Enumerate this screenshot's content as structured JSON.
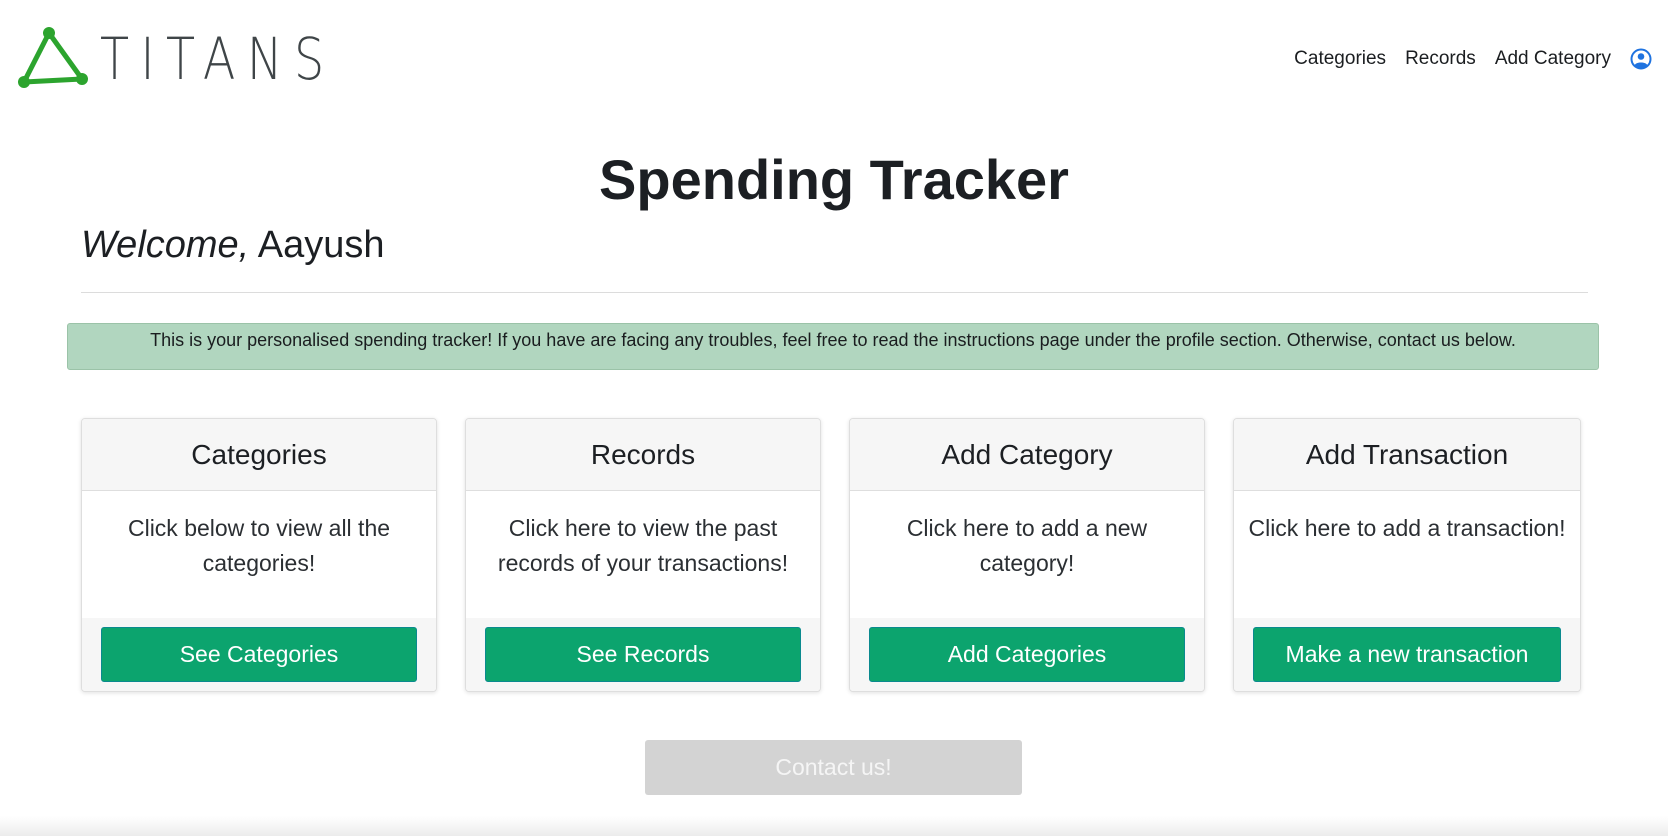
{
  "brand": {
    "name": "TITANS",
    "logo_icon": "triangle-network-icon",
    "logo_color": "#2ca42e"
  },
  "nav": {
    "links": [
      "Categories",
      "Records",
      "Add Category"
    ],
    "profile_icon": "user-circle-icon",
    "profile_color": "#1f73e0"
  },
  "main": {
    "title": "Spending Tracker",
    "welcome_prefix": "Welcome,",
    "user_name": "Aayush",
    "alert_text": "This is your personalised spending tracker! If you have are facing any troubles, feel free to read the instructions page under the profile section. Otherwise, contact us below.",
    "alert_color": "#b1d6bf"
  },
  "cards": [
    {
      "title": "Categories",
      "text": "Click below to view all the categories!",
      "button": "See Categories"
    },
    {
      "title": "Records",
      "text": "Click here to view the past records of your transactions!",
      "button": "See Records"
    },
    {
      "title": "Add Category",
      "text": "Click here to add a new category!",
      "button": "Add Categories"
    },
    {
      "title": "Add Transaction",
      "text": "Click here to add a transaction!",
      "button": "Make a new transaction"
    }
  ],
  "button_color": "#0ca46e",
  "contact": {
    "label": "Contact us!",
    "color": "#d3d3d3"
  }
}
